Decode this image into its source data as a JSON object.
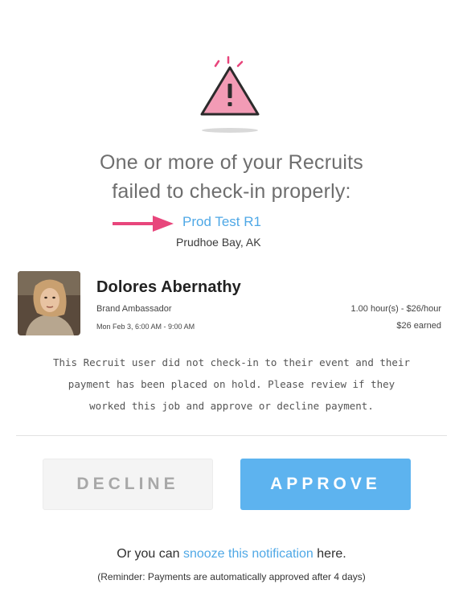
{
  "alert": {
    "icon": "warning-triangle-icon",
    "headline_line1": "One or more of your Recruits",
    "headline_line2": "failed to check-in properly:"
  },
  "event": {
    "name": "Prod Test R1",
    "location": "Prudhoe Bay, AK"
  },
  "recruit": {
    "name": "Dolores Abernathy",
    "role": "Brand Ambassador",
    "datetime": "Mon Feb 3, 6:00 AM - 9:00 AM",
    "hours_rate": "1.00 hour(s) - $26/hour",
    "earned": "$26 earned"
  },
  "message": {
    "line1": "This Recruit user did not check-in to their event and their",
    "line2": "payment has been placed on hold. Please review if they",
    "line3": "worked this job and approve or decline payment."
  },
  "actions": {
    "decline_label": "DECLINE",
    "approve_label": "APPROVE"
  },
  "snooze": {
    "prefix": "Or you can ",
    "link": "snooze this notification",
    "suffix": " here.",
    "reminder": "(Reminder: Payments are automatically approved after 4 days)"
  },
  "colors": {
    "accent": "#5db3ef",
    "link": "#4fa8e6",
    "warning_fill": "#f29bb5",
    "arrow": "#e8467c"
  }
}
